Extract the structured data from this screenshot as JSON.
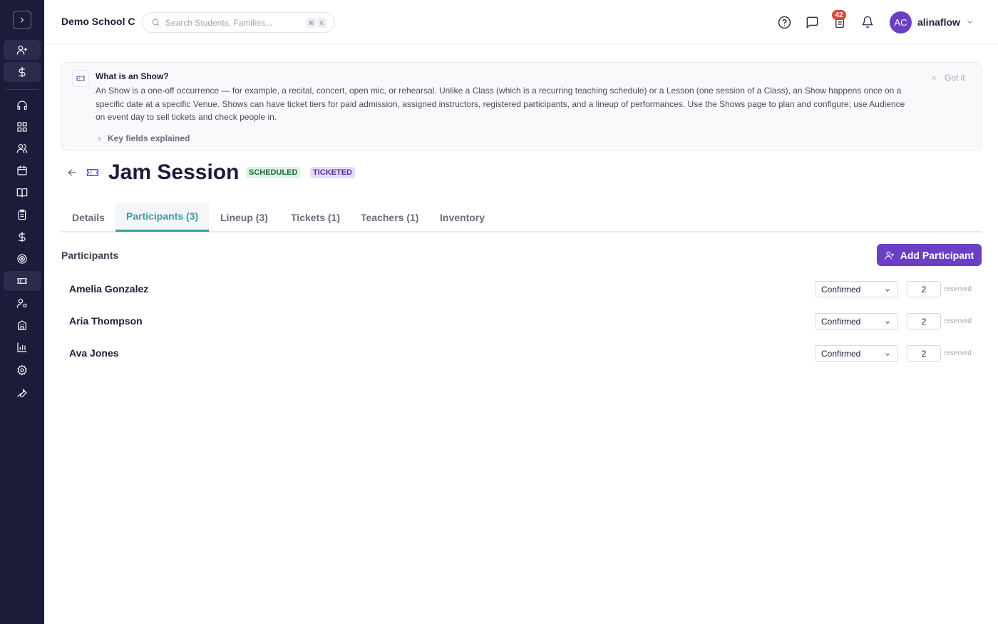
{
  "school_name": "Demo School C",
  "search": {
    "placeholder": "Search Students, Families...",
    "kbd_mod": "⌘",
    "kbd_key": "K"
  },
  "header": {
    "tasks_badge": "42",
    "user_initials": "AC",
    "username": "alinaflow"
  },
  "info": {
    "title": "What is an Show?",
    "body": "An Show is a one-off occurrence — for example, a recital, concert, open mic, or rehearsal. Unlike a Class (which is a recurring teaching schedule) or a Lesson (one session of a Class), an Show happens once on a specific date at a specific Venue. Shows can have ticket tiers for paid admission, assigned instructors, registered participants, and a lineup of performances. Use the Shows page to plan and configure; use Audience on event day to sell tickets and check people in.",
    "dismiss": "Got it",
    "key_fields": "Key fields explained"
  },
  "show": {
    "title": "Jam Session",
    "status": "SCHEDULED",
    "type": "TICKETED"
  },
  "tabs": [
    {
      "label": "Details"
    },
    {
      "label": "Participants (3)"
    },
    {
      "label": "Lineup (3)"
    },
    {
      "label": "Tickets (1)"
    },
    {
      "label": "Teachers (1)"
    },
    {
      "label": "Inventory"
    }
  ],
  "participants": {
    "title": "Participants",
    "add_label": "Add Participant",
    "reserved_label": "reserved",
    "rows": [
      {
        "name": "Amelia Gonzalez",
        "status": "Confirmed",
        "qty": "2"
      },
      {
        "name": "Aria Thompson",
        "status": "Confirmed",
        "qty": "2"
      },
      {
        "name": "Ava Jones",
        "status": "Confirmed",
        "qty": "2"
      }
    ]
  },
  "colors": {
    "sidebar": "#1c1b3a",
    "accent": "#6a3fc4",
    "tab_active": "#3a9c9c",
    "badge": "#e0463a"
  }
}
